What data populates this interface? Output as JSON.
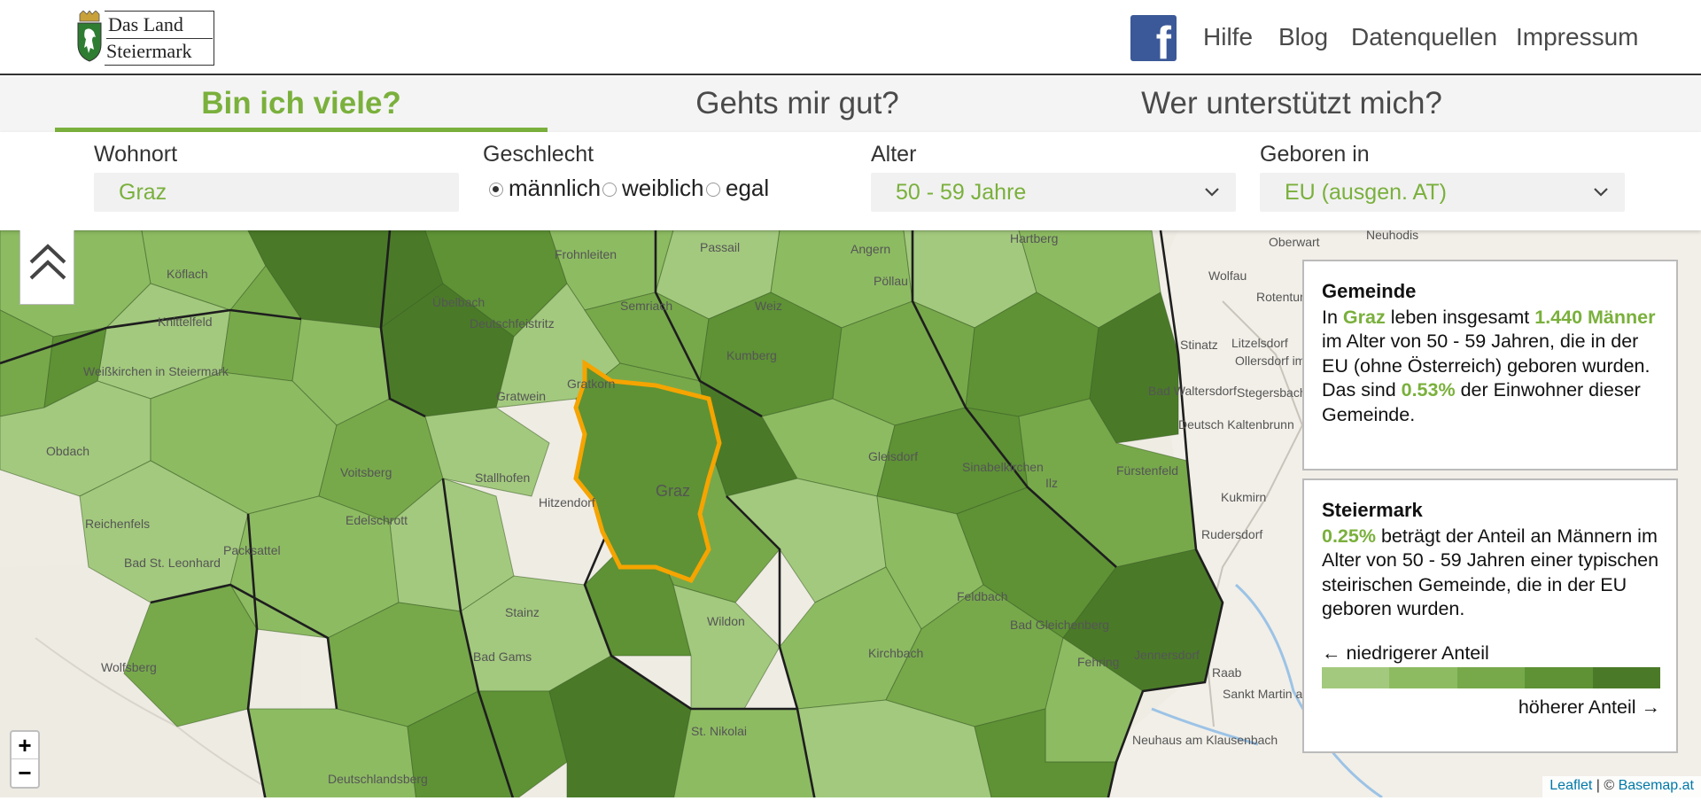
{
  "logo": {
    "line1": "Das Land",
    "line2": "Steiermark"
  },
  "nav": {
    "facebook_icon": "facebook-icon",
    "links": [
      "Hilfe",
      "Blog",
      "Datenquellen",
      "Impressum"
    ]
  },
  "tabs": [
    {
      "label": "Bin ich viele?",
      "active": true
    },
    {
      "label": "Gehts mir gut?",
      "active": false
    },
    {
      "label": "Wer unterstützt mich?",
      "active": false
    }
  ],
  "filters": {
    "wohnort": {
      "label": "Wohnort",
      "value": "Graz"
    },
    "geschlecht": {
      "label": "Geschlecht",
      "options": [
        "männlich",
        "weiblich",
        "egal"
      ],
      "selected": "männlich"
    },
    "alter": {
      "label": "Alter",
      "value": "50 - 59 Jahre"
    },
    "geboren": {
      "label": "Geboren in",
      "value": "EU (ausgen. AT)"
    }
  },
  "map": {
    "accent_color": "#7ab03c",
    "selected_outline_color": "#f5a400",
    "place_labels": [
      "Oberwart",
      "Neuhodis",
      "Hartberg",
      "Pöllau",
      "Passail",
      "Angern",
      "Frohnleiten",
      "Köflach",
      "Knittelfeld",
      "Übelbach",
      "Deutschfeistritz",
      "Semriach",
      "Weiz",
      "Kumberg",
      "Gratkorn",
      "Gratwein",
      "Weißkirchen in Steiermark",
      "Graz",
      "Stallhofen",
      "Hitzendorf",
      "Voitsberg",
      "Edelschrott",
      "Obdach",
      "Reichenfels",
      "Bad St. Leonhard",
      "Packsattel",
      "Wolfsberg",
      "Deutschlandsberg",
      "Stainz",
      "Bad Gams",
      "Wildon",
      "St. Nikolai",
      "Gleisdorf",
      "Sinabelkirchen",
      "Ilz",
      "Fürstenfeld",
      "Feldbach",
      "Fehring",
      "Jennersdorf",
      "Sankt Martin an der Raab",
      "Neuhaus am Klausenbach",
      "Rudersdorf",
      "Kukmirn",
      "Stegersbach",
      "Litzelsdorf",
      "Stinatz",
      "Wolfau",
      "Bad Waltersdorf",
      "Bad Gleichenberg",
      "Kirchbach",
      "Raab",
      "Ollersdorf im Burgenland",
      "Rotenturm an der Pinka",
      "Deutsch Kaltenbrunn"
    ],
    "zoom_in": "+",
    "zoom_out": "−",
    "attribution_leaflet": "Leaflet",
    "attribution_sep": " | © ",
    "attribution_basemap": "Basemap.at"
  },
  "gemeinde": {
    "title": "Gemeinde",
    "t1": "In ",
    "place": "Graz",
    "t2": " leben insgesamt ",
    "count": "1.440 Männer",
    "t3": " im Alter von 50 - 59 Jahren, die in der EU (ohne Österreich) geboren wurden.",
    "t4": "Das sind ",
    "share": "0.53%",
    "t5": " der Einwohner dieser Gemeinde."
  },
  "steiermark": {
    "title": "Steiermark",
    "share": "0.25%",
    "t1": " beträgt der Anteil an Männern im Alter von 50 - 59 Jahren einer typischen steirischen Gemeinde, die in der EU geboren wurden.",
    "legend_low": "← niedrigerer Anteil",
    "legend_high": "höherer Anteil →",
    "legend_colors": [
      "#a3c97e",
      "#8dbb62",
      "#77a94b",
      "#5e9235",
      "#4a7a28"
    ]
  }
}
